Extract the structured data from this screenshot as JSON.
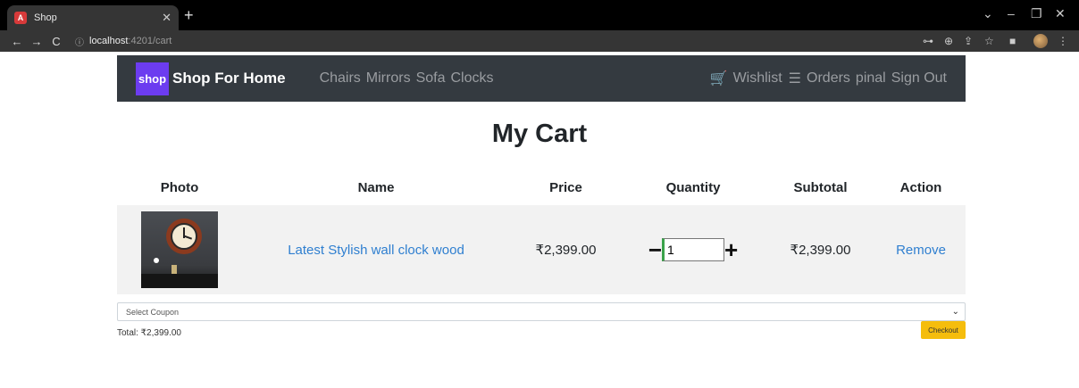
{
  "browser": {
    "tab_title": "Shop",
    "favicon": "A",
    "url_host": "localhost",
    "url_rest": ":4201/cart"
  },
  "nav": {
    "logo": "shop",
    "brand": "Shop For Home",
    "links": [
      "Chairs",
      "Mirrors",
      "Sofa",
      "Clocks"
    ],
    "wishlist": "Wishlist",
    "orders": "Orders",
    "user": "pinal",
    "signout": "Sign Out"
  },
  "page": {
    "title": "My Cart"
  },
  "table": {
    "headers": [
      "Photo",
      "Name",
      "Price",
      "Quantity",
      "Subtotal",
      "Action"
    ],
    "rows": [
      {
        "name": "Latest Stylish wall clock wood",
        "price": "₹2,399.00",
        "quantity": "1",
        "subtotal": "₹2,399.00",
        "action": "Remove"
      }
    ]
  },
  "coupon": {
    "placeholder": "Select Coupon"
  },
  "total": "Total: ₹2,399.00",
  "checkout": "Checkout",
  "colors": {
    "nav_bg": "#343a40",
    "link": "#2f7fd0",
    "checkout": "#f5bd0d",
    "logo_bg": "#6c3cf0"
  }
}
